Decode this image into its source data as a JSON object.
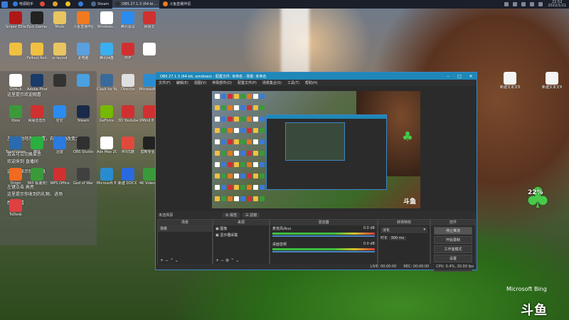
{
  "taskbar": {
    "tasks": [
      {
        "label": "电源助手",
        "color": "#2d7cd6",
        "active": false
      },
      {
        "label": "",
        "color": "#e04a3c",
        "active": false
      },
      {
        "label": "",
        "color": "#e0a030",
        "active": false
      },
      {
        "label": "",
        "color": "#f0c020",
        "active": false
      },
      {
        "label": "",
        "color": "#3a78d8",
        "active": false
      },
      {
        "label": "Steam",
        "color": "#4a6a8a",
        "active": false
      },
      {
        "label": "OBS 27.1.3 (64-bi...",
        "color": "#303030",
        "active": true
      },
      {
        "label": "斗鱼直播伴侣",
        "color": "#f07a20",
        "active": false
      }
    ],
    "time": "22:52",
    "date": "2022/1/11"
  },
  "desktop_icons": [
    {
      "label": "Sniper Elite 4",
      "color": "#b01818"
    },
    {
      "label": "Epic Games",
      "color": "#222222"
    },
    {
      "label": "Mods",
      "color": "#e8c560"
    },
    {
      "label": "斗鱼直播伴侣",
      "color": "#f07a20"
    },
    {
      "label": "Windows...",
      "color": "#ffffff"
    },
    {
      "label": "腾讯会议",
      "color": "#2a8cf0"
    },
    {
      "label": "网易云",
      "color": "#d03030"
    },
    {
      "label": "",
      "color": "#f0c040"
    },
    {
      "label": "Fallout Reloaded",
      "color": "#f0c040"
    },
    {
      "label": "ui-layout",
      "color": "#e8c560"
    },
    {
      "label": "此电脑",
      "color": "#5aa0e0"
    },
    {
      "label": "腾讯网盘",
      "color": "#3ab0f0"
    },
    {
      "label": "PDF",
      "color": "#d03030"
    },
    {
      "label": "",
      "color": "#ffffff"
    },
    {
      "label": "GitHub",
      "color": "#ffffff"
    },
    {
      "label": "Adobe Photoshop",
      "color": "#1a3a6a"
    },
    {
      "label": "",
      "color": "#333333"
    },
    {
      "label": "",
      "color": "#4aa0e0"
    },
    {
      "label": "Clash for Windows",
      "color": "#3a6a9a"
    },
    {
      "label": "Director",
      "color": "#e0e0e0"
    },
    {
      "label": "Microsoft Edge",
      "color": "#2a8cd0"
    },
    {
      "label": "Xbox",
      "color": "#3a9a3a"
    },
    {
      "label": "网易云音乐",
      "color": "#d03030"
    },
    {
      "label": "钉钉",
      "color": "#2a8cf0"
    },
    {
      "label": "Steam",
      "color": "#1a2a4a"
    },
    {
      "label": "GeForce",
      "color": "#76b900"
    },
    {
      "label": "3D Youtube Downloader",
      "color": "#d03030"
    },
    {
      "label": "XMind 8 Update 9",
      "color": "#d03030"
    },
    {
      "label": "TeamViewer",
      "color": "#2a6ab0"
    },
    {
      "label": "微信",
      "color": "#2ab040"
    },
    {
      "label": "迅雷",
      "color": "#2a7ae0"
    },
    {
      "label": "OBS Studio",
      "color": "#303030"
    },
    {
      "label": "Ads Max 2022",
      "color": "#ffffff"
    },
    {
      "label": "MX优酷",
      "color": "#e04a3c"
    },
    {
      "label": "剪映专业版",
      "color": "#222222"
    },
    {
      "label": "Origin",
      "color": "#f06a20"
    },
    {
      "label": "360 极速浏览器",
      "color": "#3a9a3a"
    },
    {
      "label": "WPS Office",
      "color": "#d03030"
    },
    {
      "label": "God of War",
      "color": "#404040"
    },
    {
      "label": "Microsoft Edge",
      "color": "#2a8cd0"
    },
    {
      "label": "新建 DOCX 文档.docx",
      "color": "#2a6ae0"
    },
    {
      "label": "4K Video Downloader",
      "color": "#3a9a3a"
    },
    {
      "label": "ToDesk",
      "color": "#e04040"
    }
  ],
  "right_icons": [
    {
      "label": "新建文本文档(5).txt"
    },
    {
      "label": "新建文本文档(2).txt"
    }
  ],
  "chat_messages": [
    "这里提示欢迎观看",
    "左键拖动可改变位置，右键拖动改变大小",
    "双击可以切换显示",
    "欢迎来到 直播间",
    "这里会显示弹幕信息",
    "左键点击 高亮",
    "这里提示你收到的礼物、进场",
    "感谢观看"
  ],
  "obs": {
    "title": "OBS 27.1.3 (64-bit, windows) - 配置文件: 未命名 - 场景: 未命名",
    "menu": [
      "文件(F)",
      "编辑(E)",
      "视图(V)",
      "停靠部件(D)",
      "配置文件(P)",
      "场景集合(S)",
      "工具(T)",
      "帮助(H)"
    ],
    "scene_label": "未选择源",
    "toolbar": {
      "properties": "属性",
      "filters": "滤镜"
    },
    "docks": {
      "scenes": {
        "title": "场景",
        "items": [
          "场景"
        ]
      },
      "sources": {
        "title": "来源",
        "items": [
          "图像",
          "显示器采集"
        ]
      },
      "mixer": {
        "title": "混音器",
        "channels": [
          {
            "name": "桌面音频",
            "value": "0.0 dB"
          },
          {
            "name": "麦克风/Aux",
            "value": "0.0 dB"
          }
        ]
      },
      "transitions": {
        "title": "转场特效",
        "type": "淡化",
        "duration_label": "时长",
        "duration": "300 ms"
      },
      "controls": {
        "title": "控件",
        "buttons": [
          "停止推流",
          "开始录制",
          "工作室模式",
          "设置",
          "退出"
        ]
      }
    },
    "status": {
      "live": "LIVE: 00:00:00",
      "rec": "REC: 00:00:00",
      "cpu": "CPU: 0.4%, 30.00 fps"
    }
  },
  "overlay": {
    "percent": "22%",
    "bing": "Microsoft Bing",
    "watermark": "斗鱼"
  }
}
